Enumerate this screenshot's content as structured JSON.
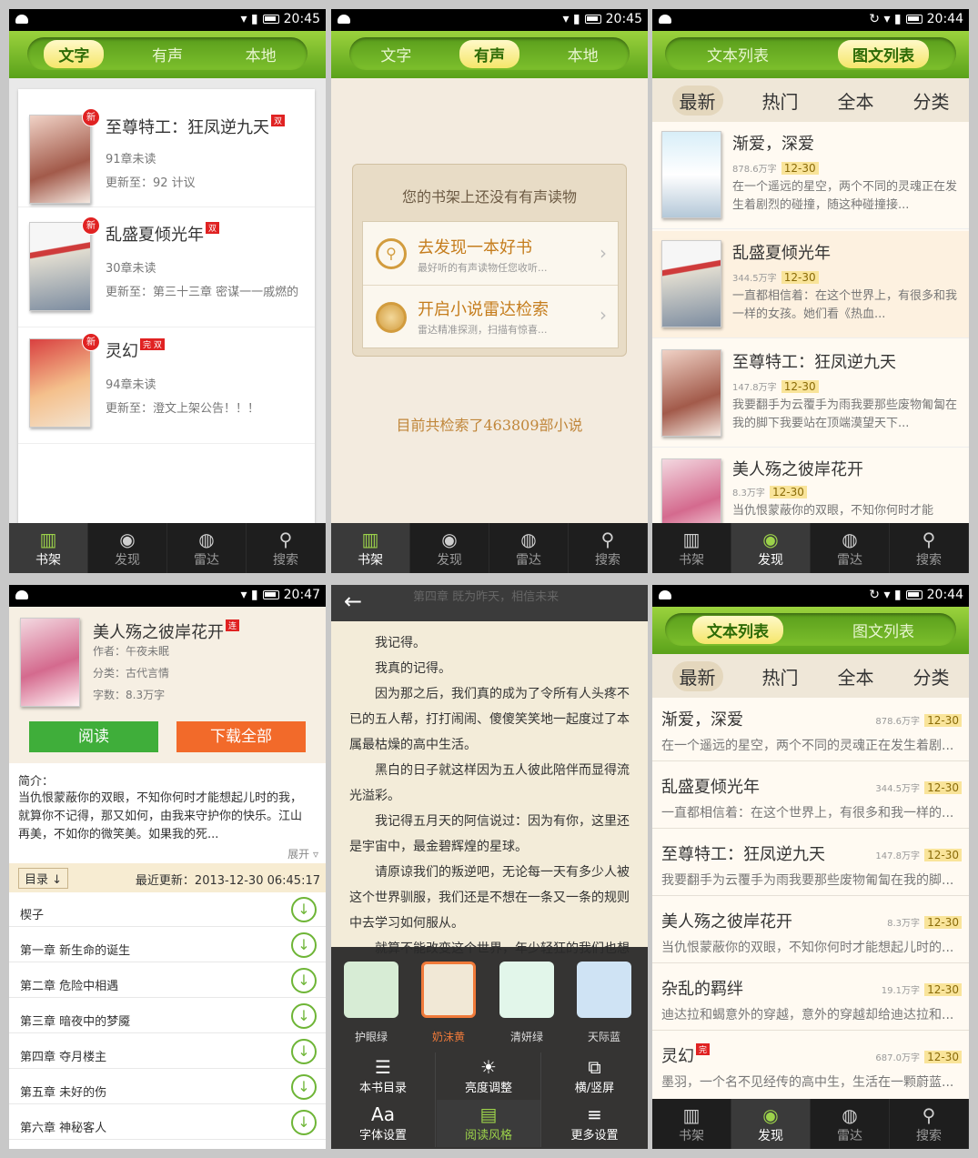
{
  "status": {
    "p1": "20:45",
    "p2": "20:45",
    "p3": "20:44",
    "p4": "20:47",
    "p6": "20:44"
  },
  "tabs1": [
    "文字",
    "有声",
    "本地"
  ],
  "tabs3": [
    "文本列表",
    "图文列表"
  ],
  "cats": [
    "最新",
    "热门",
    "全本",
    "分类"
  ],
  "bottom": [
    "书架",
    "发现",
    "雷达",
    "搜索"
  ],
  "shelf": [
    {
      "title": "至尊特工：狂凤逆九天",
      "tag": "双",
      "badge": "新",
      "unread": "91章未读",
      "update": "更新至：92 计议"
    },
    {
      "title": "乱盛夏倾光年",
      "tag": "双",
      "badge": "新",
      "unread": "30章未读",
      "update": "更新至：第三十三章 密谋一一戚燃的"
    },
    {
      "title": "灵幻",
      "tag": "完 双",
      "badge": "新",
      "unread": "94章未读",
      "update": "更新至：澄文上架公告！！！"
    }
  ],
  "audio": {
    "empty": "您的书架上还没有有声读物",
    "item1": {
      "title": "去发现一本好书",
      "sub": "最好听的有声读物任您收听..."
    },
    "item2": {
      "title": "开启小说雷达检索",
      "sub": "雷达精准探测，扫描有惊喜..."
    },
    "footer": "目前共检索了463809部小说"
  },
  "list3": [
    {
      "title": "渐爱，深爱",
      "words": "878.6万字",
      "date": "12-30",
      "desc": "在一个遥远的星空，两个不同的灵魂正在发生着剧烈的碰撞，随这种碰撞接..."
    },
    {
      "title": "乱盛夏倾光年",
      "words": "344.5万字",
      "date": "12-30",
      "desc": "一直都相信着：在这个世界上，有很多和我一样的女孩。她们看《热血..."
    },
    {
      "title": "至尊特工：狂凤逆九天",
      "words": "147.8万字",
      "date": "12-30",
      "desc": "我要翻手为云覆手为雨我要那些废物匍匐在我的脚下我要站在顶端漠望天下..."
    },
    {
      "title": "美人殇之彼岸花开",
      "words": "8.3万字",
      "date": "12-30",
      "desc": "当仇恨蒙蔽你的双眼，不知你何时才能"
    }
  ],
  "detail": {
    "title": "美人殇之彼岸花开",
    "tag": "连",
    "author": "作者：午夜未眠",
    "category": "分类：古代言情",
    "words": "字数：8.3万字",
    "read": "阅读",
    "download": "下载全部",
    "intro_label": "简介：",
    "intro": "当仇恨蒙蔽你的双眼，不知你何时才能想起儿时的我，就算你不记得，那又如何，由我来守护你的快乐。江山再美，不如你的微笑美。如果我的死...",
    "expand": "展开",
    "toc": "目录 ↓",
    "last_update": "最近更新：2013-12-30 06:45:17",
    "chapters": [
      "楔子",
      "第一章 新生命的诞生",
      "第二章 危险中相遇",
      "第三章 暗夜中的梦魇",
      "第四章 夺月楼主",
      "第五章 未好的伤",
      "第六章 神秘客人"
    ]
  },
  "reader": {
    "header": "第四章 既为昨天，相信未来",
    "paras": [
      "我记得。",
      "我真的记得。",
      "因为那之后，我们真的成为了令所有人头疼不已的五人帮，打打闹闹、傻傻笑笑地一起度过了本属最枯燥的高中生活。",
      "黑白的日子就这样因为五人彼此陪伴而显得流光溢彩。",
      "我记得五月天的阿信说过：因为有你，这里还是宇宙中，最金碧辉煌的星球。",
      "请原谅我们的叛逆吧，无论每一天有多少人被这个世界驯服，我们还是不想在一条又一条的规则中去学习如何服从。",
      "就算不能改变这个世界，年少轻狂的我们也想"
    ],
    "swatches": [
      {
        "label": "护眼绿",
        "color": "#d7ecd5"
      },
      {
        "label": "奶沫黄",
        "color": "#f1e8d6"
      },
      {
        "label": "清妍绿",
        "color": "#e2f6ea"
      },
      {
        "label": "天际蓝",
        "color": "#cfe3f4"
      }
    ],
    "menu": [
      "本书目录",
      "亮度调整",
      "横/竖屏",
      "字体设置",
      "阅读风格",
      "更多设置"
    ]
  },
  "list6": [
    {
      "title": "渐爱，深爱",
      "words": "878.6万字",
      "date": "12-30",
      "desc": "在一个遥远的星空，两个不同的灵魂正在发生着剧..."
    },
    {
      "title": "乱盛夏倾光年",
      "words": "344.5万字",
      "date": "12-30",
      "desc": "一直都相信着：在这个世界上，有很多和我一样的..."
    },
    {
      "title": "至尊特工：狂凤逆九天",
      "words": "147.8万字",
      "date": "12-30",
      "desc": "我要翻手为云覆手为雨我要那些废物匍匐在我的脚..."
    },
    {
      "title": "美人殇之彼岸花开",
      "words": "8.3万字",
      "date": "12-30",
      "desc": "当仇恨蒙蔽你的双眼，不知你何时才能想起儿时的..."
    },
    {
      "title": "杂乱的羁绊",
      "words": "19.1万字",
      "date": "12-30",
      "desc": "迪达拉和蝎意外的穿越，意外的穿越却给迪达拉和..."
    },
    {
      "title": "灵幻",
      "tag": "完",
      "words": "687.0万字",
      "date": "12-30",
      "desc": "墨羽，一个名不见经传的高中生，生活在一颗蔚蓝..."
    }
  ]
}
